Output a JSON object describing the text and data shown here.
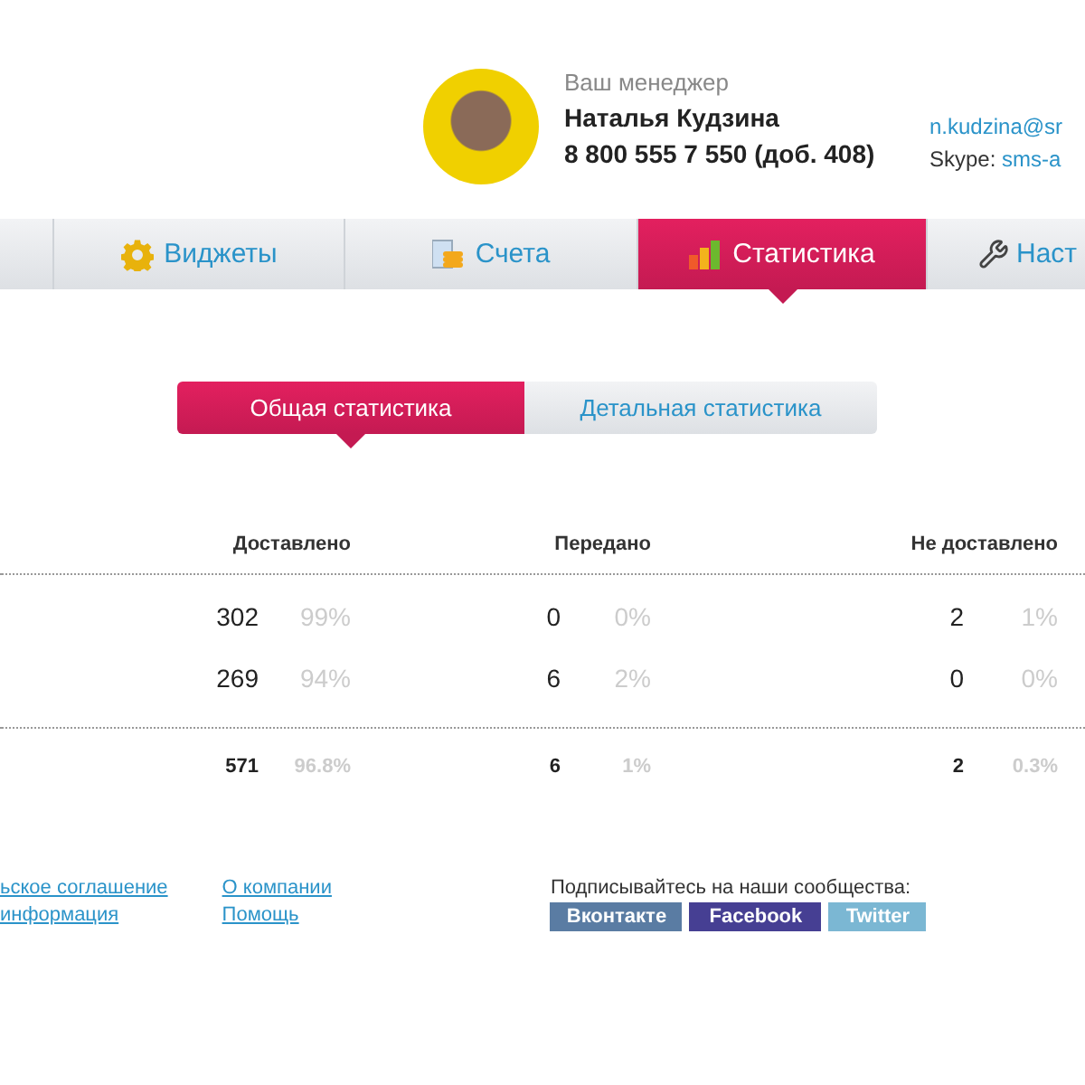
{
  "manager": {
    "caption": "Ваш менеджер",
    "name": "Наталья Кудзина",
    "phone": "8 800 555 7 550 (доб. 408)",
    "email": "n.kudzina@sr",
    "skype_label": "Skype:",
    "skype": "sms-a"
  },
  "nav": [
    {
      "selected": false
    },
    {
      "label": "Виджеты",
      "selected": false
    },
    {
      "label": "Счета",
      "selected": false
    },
    {
      "label": "Статистика",
      "selected": true
    },
    {
      "label": "Наст",
      "selected": false
    }
  ],
  "subtabs": [
    {
      "label": "Общая статистика",
      "selected": true
    },
    {
      "label": "Детальная статистика",
      "selected": false
    }
  ],
  "table": {
    "columns": [
      "Доставлено",
      "Передано",
      "Не доставлено"
    ],
    "rows": [
      [
        [
          "302",
          "99%"
        ],
        [
          "0",
          "0%"
        ],
        [
          "2",
          "1%"
        ]
      ],
      [
        [
          "269",
          "94%"
        ],
        [
          "6",
          "2%"
        ],
        [
          "0",
          "0%"
        ]
      ]
    ],
    "totals": [
      [
        "571",
        "96.8%"
      ],
      [
        "6",
        "1%"
      ],
      [
        "2",
        "0.3%"
      ]
    ]
  },
  "footer": {
    "links": [
      [
        "ьское соглашение",
        "информация"
      ],
      [
        "О компании",
        "Помощь"
      ]
    ],
    "subscribe": "Подписывайтесь на наши сообщества:",
    "social": [
      {
        "label": "Вконтакте",
        "color": "#5a7ca3"
      },
      {
        "label": "Facebook",
        "color": "#463f93"
      },
      {
        "label": "Twitter",
        "color": "#7bb7d3"
      }
    ]
  }
}
